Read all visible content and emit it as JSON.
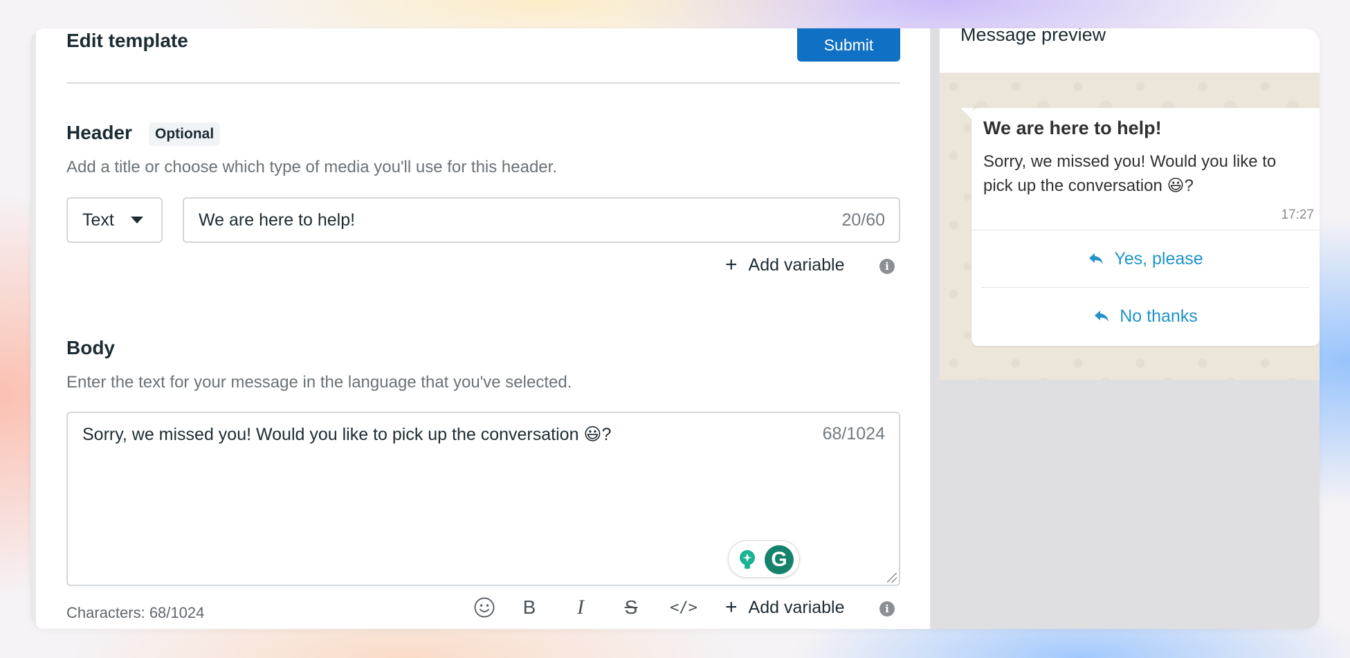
{
  "editor": {
    "title": "Edit template",
    "submit_label": "Submit",
    "header": {
      "title": "Header",
      "badge": "Optional",
      "help": "Add a title or choose which type of media you'll use for this header.",
      "type_value": "Text",
      "input_value": "We are here to help!",
      "counter": "20/60",
      "add_variable_label": "Add variable"
    },
    "body": {
      "title": "Body",
      "help": "Enter the text for your message in the language that you've selected.",
      "text_value": "Sorry, we missed you! Would you like to pick up the conversation 😃?",
      "counter": "68/1024",
      "characters_label": "Characters: 68/1024",
      "add_variable_label": "Add variable",
      "toolbar": {
        "emoji_icon": "smiley-icon",
        "bold_label": "B",
        "italic_label": "I",
        "strike_label": "S",
        "code_label": "</>"
      }
    }
  },
  "preview": {
    "title": "Message preview",
    "message": {
      "title": "We are here to help!",
      "body": "Sorry, we missed you! Would you like to pick up the conversation 😃?",
      "time": "17:27"
    },
    "quick_replies": [
      {
        "label": "Yes, please"
      },
      {
        "label": "No thanks"
      }
    ]
  },
  "colors": {
    "accent": "#1070c4",
    "link": "#1f93c9",
    "grammarly": "#15826b",
    "text": "#1c2b33"
  }
}
